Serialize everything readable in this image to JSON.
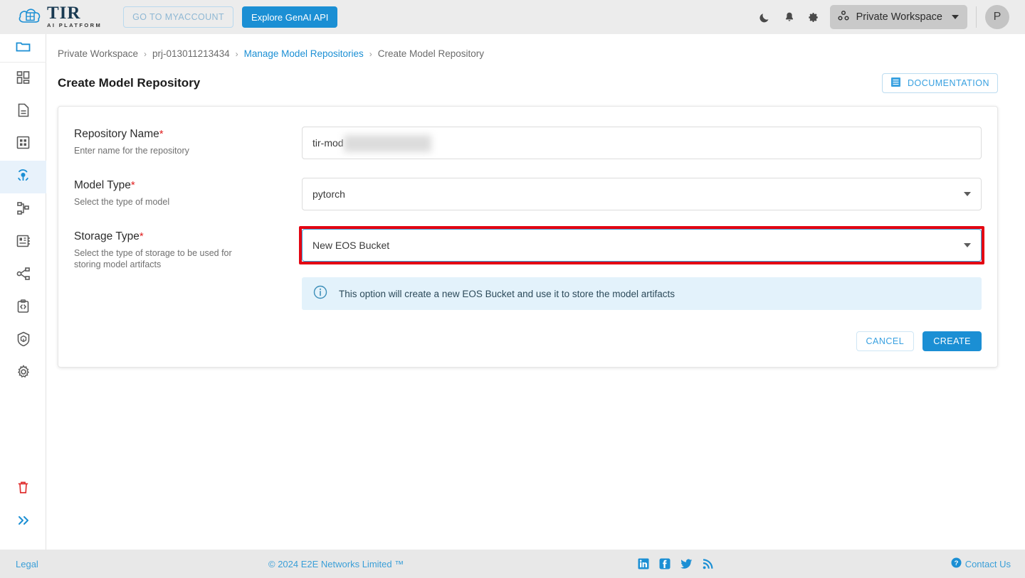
{
  "topbar": {
    "brand_name": "TIR",
    "brand_tagline": "AI PLATFORM",
    "myaccount_label": "GO TO MYACCOUNT",
    "genai_label": "Explore GenAI API",
    "workspace_label": "Private Workspace",
    "avatar_initial": "P",
    "icons": [
      "dark-mode-icon",
      "notifications-icon",
      "settings-icon"
    ]
  },
  "sidebar": {
    "items": [
      {
        "name": "projects-folder",
        "icon": "folder-icon",
        "active_accent": true
      },
      {
        "name": "dashboard",
        "icon": "dashboard-grid-icon"
      },
      {
        "name": "notebooks",
        "icon": "document-icon"
      },
      {
        "name": "datasets",
        "icon": "table-grid-icon"
      },
      {
        "name": "model-repositories",
        "icon": "model-hub-icon",
        "active": true
      },
      {
        "name": "pipelines",
        "icon": "pipeline-nodes-icon"
      },
      {
        "name": "inference",
        "icon": "server-rack-icon"
      },
      {
        "name": "deployments",
        "icon": "share-nodes-icon"
      },
      {
        "name": "api-tokens",
        "icon": "code-clipboard-icon"
      },
      {
        "name": "containers",
        "icon": "cube-shield-icon"
      },
      {
        "name": "settings",
        "icon": "gear-icon"
      }
    ],
    "trash_icon": "trash-icon",
    "expand_icon": "chevron-double-right-icon"
  },
  "breadcrumb": {
    "items": [
      {
        "label": "Private Workspace",
        "link": false
      },
      {
        "label": "prj-013011213434",
        "link": false
      },
      {
        "label": "Manage Model Repositories",
        "link": true
      },
      {
        "label": "Create Model Repository",
        "link": false
      }
    ],
    "separator": "›"
  },
  "page": {
    "title": "Create Model Repository",
    "documentation_label": "DOCUMENTATION",
    "documentation_icon": "document-list-icon"
  },
  "form": {
    "fields": [
      {
        "label": "Repository Name",
        "required_mark": "*",
        "description": "Enter name for the repository",
        "value": "tir-mod",
        "redacted": true
      },
      {
        "label": "Model Type",
        "required_mark": "*",
        "description": "Select the type of model",
        "value": "pytorch"
      },
      {
        "label": "Storage Type",
        "required_mark": "*",
        "description": "Select the type of storage to be used for storing model artifacts",
        "value": "New EOS Bucket",
        "highlighted": true
      }
    ],
    "info_message": "This option will create a new EOS Bucket and use it to store the model artifacts",
    "info_icon": "info-circle-icon",
    "cancel_label": "CANCEL",
    "create_label": "CREATE"
  },
  "footer": {
    "legal": "Legal",
    "copyright": "© 2024 E2E Networks Limited ™",
    "contact": "Contact Us",
    "contact_icon": "help-circle-icon",
    "social": [
      "linkedin-icon",
      "facebook-icon",
      "twitter-icon",
      "rss-icon"
    ]
  },
  "colors": {
    "accent": "#1b8fd4",
    "highlight": "#e30613",
    "required": "#e02020",
    "info_bg": "#e3f2fb"
  }
}
